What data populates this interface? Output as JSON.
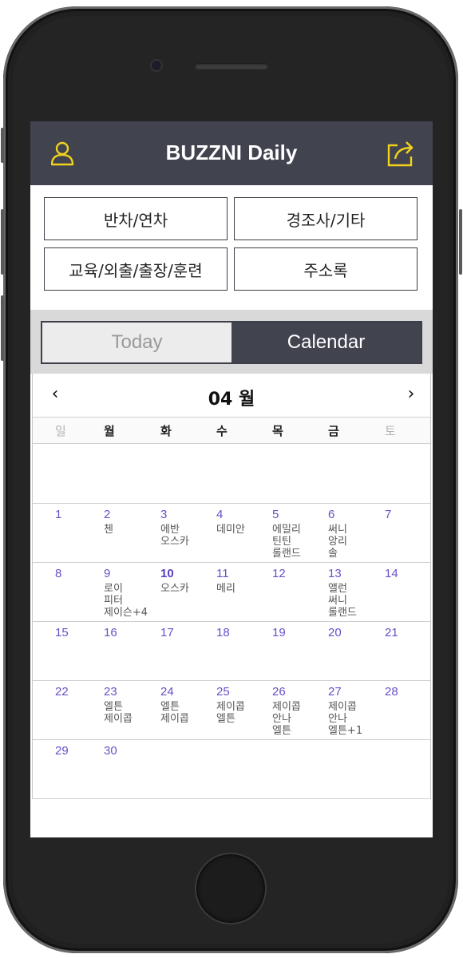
{
  "app": {
    "title": "BUZZNI Daily",
    "header_color": "#41434f",
    "accent_icon_color": "#f2d21c",
    "day_number_color": "#6a4fc8"
  },
  "header": {
    "left_icon": "user-profile-icon",
    "right_icon": "share-icon"
  },
  "menu": {
    "leave": "반차/연차",
    "event": "경조사/기타",
    "training": "교육/외출/출장/훈련",
    "contacts": "주소록"
  },
  "tabs": {
    "today": "Today",
    "calendar": "Calendar",
    "selected": "Calendar"
  },
  "calendar": {
    "month_label": "04 월",
    "prev_icon": "chevron-left-icon",
    "next_icon": "chevron-right-icon",
    "prev_glyph": "‹",
    "next_glyph": "›",
    "weekdays": [
      "일",
      "월",
      "화",
      "수",
      "목",
      "금",
      "토"
    ],
    "today": "10",
    "weeks": [
      [
        {
          "day": "",
          "names": []
        },
        {
          "day": "",
          "names": []
        },
        {
          "day": "",
          "names": []
        },
        {
          "day": "",
          "names": []
        },
        {
          "day": "",
          "names": []
        },
        {
          "day": "",
          "names": []
        },
        {
          "day": "",
          "names": []
        }
      ],
      [
        {
          "day": "1",
          "names": []
        },
        {
          "day": "2",
          "names": [
            "첸"
          ]
        },
        {
          "day": "3",
          "names": [
            "에반",
            "오스카"
          ]
        },
        {
          "day": "4",
          "names": [
            "데미안"
          ]
        },
        {
          "day": "5",
          "names": [
            "에밀리",
            "틴틴",
            "롤랜드"
          ]
        },
        {
          "day": "6",
          "names": [
            "써니",
            "앙리",
            "솔"
          ]
        },
        {
          "day": "7",
          "names": []
        }
      ],
      [
        {
          "day": "8",
          "names": []
        },
        {
          "day": "9",
          "names": [
            "로이",
            "피터",
            "제이슨+4"
          ]
        },
        {
          "day": "10",
          "names": [
            "오스카"
          ]
        },
        {
          "day": "11",
          "names": [
            "메리"
          ]
        },
        {
          "day": "12",
          "names": []
        },
        {
          "day": "13",
          "names": [
            "앨런",
            "써니",
            "롤랜드"
          ]
        },
        {
          "day": "14",
          "names": []
        }
      ],
      [
        {
          "day": "15",
          "names": []
        },
        {
          "day": "16",
          "names": []
        },
        {
          "day": "17",
          "names": []
        },
        {
          "day": "18",
          "names": []
        },
        {
          "day": "19",
          "names": []
        },
        {
          "day": "20",
          "names": []
        },
        {
          "day": "21",
          "names": []
        }
      ],
      [
        {
          "day": "22",
          "names": []
        },
        {
          "day": "23",
          "names": [
            "엘튼",
            "제이콥"
          ]
        },
        {
          "day": "24",
          "names": [
            "엘튼",
            "제이콥"
          ]
        },
        {
          "day": "25",
          "names": [
            "제이콥",
            "엘튼"
          ]
        },
        {
          "day": "26",
          "names": [
            "제이콥",
            "안나",
            "엘튼"
          ]
        },
        {
          "day": "27",
          "names": [
            "제이콥",
            "안나",
            "엘튼+1"
          ]
        },
        {
          "day": "28",
          "names": []
        }
      ],
      [
        {
          "day": "29",
          "names": []
        },
        {
          "day": "30",
          "names": []
        },
        {
          "day": "",
          "names": []
        },
        {
          "day": "",
          "names": []
        },
        {
          "day": "",
          "names": []
        },
        {
          "day": "",
          "names": []
        },
        {
          "day": "",
          "names": []
        }
      ]
    ]
  }
}
